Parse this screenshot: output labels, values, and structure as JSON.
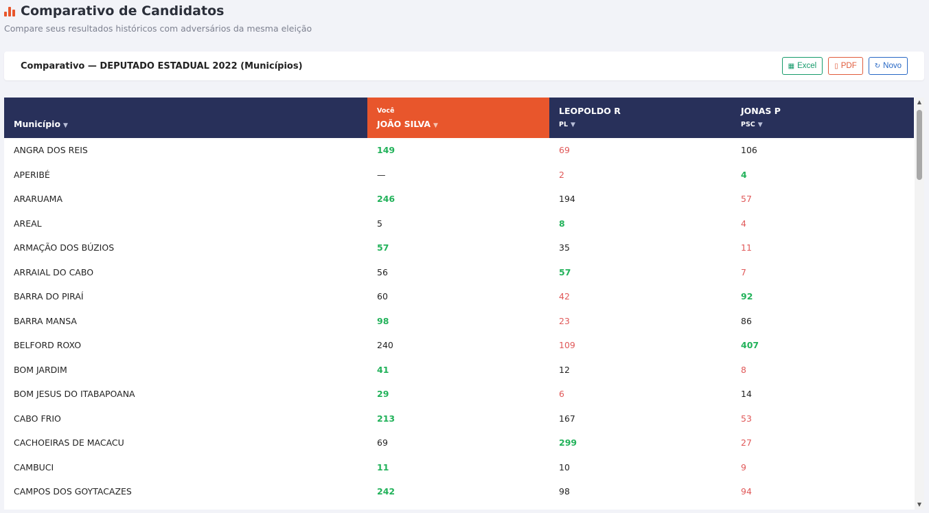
{
  "header": {
    "title": "Comparativo de Candidatos",
    "subtitle": "Compare seus resultados históricos com adversários da mesma eleição"
  },
  "toolbar": {
    "title": "Comparativo — DEPUTADO ESTADUAL 2022 (Municípios)",
    "excel_label": "Excel",
    "pdf_label": "PDF",
    "novo_label": "Novo"
  },
  "table": {
    "col_municipio": "Município",
    "you": {
      "tag": "Você",
      "name": "JOÃO SILVA"
    },
    "candidates": [
      {
        "name": "LEOPOLDO R",
        "party": "PL"
      },
      {
        "name": "JONAS P",
        "party": "PSC"
      }
    ],
    "rows": [
      {
        "municipio": "ANGRA DOS REIS",
        "values": [
          "149",
          "69",
          "106"
        ],
        "best": 0,
        "worst": 1
      },
      {
        "municipio": "APERIBÉ",
        "values": [
          "—",
          "2",
          "4"
        ],
        "best": 2,
        "worst": 1
      },
      {
        "municipio": "ARARUAMA",
        "values": [
          "246",
          "194",
          "57"
        ],
        "best": 0,
        "worst": 2
      },
      {
        "municipio": "AREAL",
        "values": [
          "5",
          "8",
          "4"
        ],
        "best": 1,
        "worst": 2
      },
      {
        "municipio": "ARMAÇÃO DOS BÚZIOS",
        "values": [
          "57",
          "35",
          "11"
        ],
        "best": 0,
        "worst": 2
      },
      {
        "municipio": "ARRAIAL DO CABO",
        "values": [
          "56",
          "57",
          "7"
        ],
        "best": 1,
        "worst": 2
      },
      {
        "municipio": "BARRA DO PIRAÍ",
        "values": [
          "60",
          "42",
          "92"
        ],
        "best": 2,
        "worst": 1
      },
      {
        "municipio": "BARRA MANSA",
        "values": [
          "98",
          "23",
          "86"
        ],
        "best": 0,
        "worst": 1
      },
      {
        "municipio": "BELFORD ROXO",
        "values": [
          "240",
          "109",
          "407"
        ],
        "best": 2,
        "worst": 1
      },
      {
        "municipio": "BOM JARDIM",
        "values": [
          "41",
          "12",
          "8"
        ],
        "best": 0,
        "worst": 2
      },
      {
        "municipio": "BOM JESUS DO ITABAPOANA",
        "values": [
          "29",
          "6",
          "14"
        ],
        "best": 0,
        "worst": 1
      },
      {
        "municipio": "CABO FRIO",
        "values": [
          "213",
          "167",
          "53"
        ],
        "best": 0,
        "worst": 2
      },
      {
        "municipio": "CACHOEIRAS DE MACACU",
        "values": [
          "69",
          "299",
          "27"
        ],
        "best": 1,
        "worst": 2
      },
      {
        "municipio": "CAMBUCI",
        "values": [
          "11",
          "10",
          "9"
        ],
        "best": 0,
        "worst": 2
      },
      {
        "municipio": "CAMPOS DOS GOYTACAZES",
        "values": [
          "242",
          "98",
          "94"
        ],
        "best": 0,
        "worst": 2
      }
    ]
  },
  "colors": {
    "accent": "#e8562c",
    "header_bg": "#28305a",
    "best": "#22b25a",
    "worst": "#e05858"
  },
  "icons": {
    "title": "bar-chart-icon",
    "excel": "spreadsheet-icon",
    "pdf": "pdf-file-icon",
    "novo": "refresh-icon"
  }
}
